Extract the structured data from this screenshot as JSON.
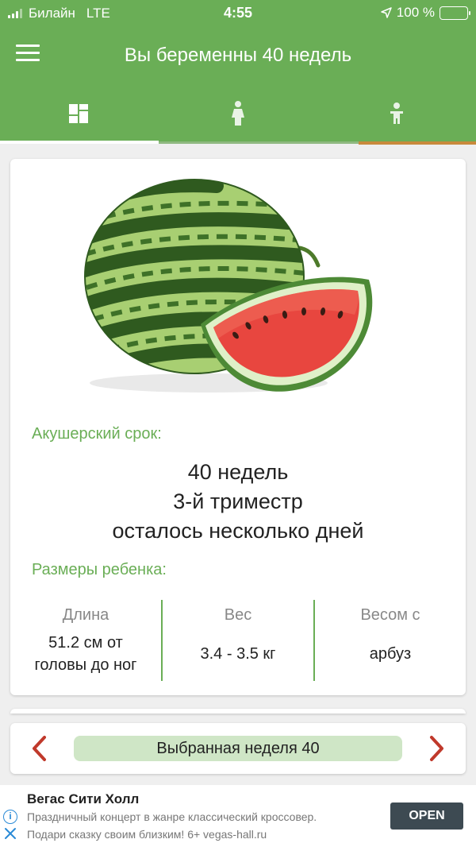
{
  "status_bar": {
    "carrier": "Билайн",
    "network": "LTE",
    "time": "4:55",
    "battery": "100 %",
    "battery_level": 1.0
  },
  "header": {
    "title": "Вы беременны 40 недель",
    "menu_icon": "hamburger-menu-icon",
    "tabs": [
      {
        "icon": "dashboard-grid-icon",
        "active": true
      },
      {
        "icon": "pregnant-woman-icon",
        "active": false
      },
      {
        "icon": "baby-child-icon",
        "active": false
      }
    ]
  },
  "main_card": {
    "image": "watermelon",
    "term_label": "Акушерский срок:",
    "term_lines": [
      "40 недель",
      "3-й триместр",
      "осталось несколько дней"
    ],
    "sizes_label": "Размеры ребенка:",
    "sizes": [
      {
        "head": "Длина",
        "value": "51.2 см от головы до ног"
      },
      {
        "head": "Вес",
        "value": "3.4 - 3.5 кг"
      },
      {
        "head": "Весом с",
        "value": "арбуз"
      }
    ]
  },
  "week_selector": {
    "label": "Выбранная неделя 40",
    "prev_icon": "chevron-left-icon",
    "next_icon": "chevron-right-icon"
  },
  "ad": {
    "title": "Вегас Сити Холл",
    "line1": "Праздничный концерт в жанре классический кроссовер.",
    "line2": "Подари сказку своим близким! 6+ vegas-hall.ru",
    "cta": "OPEN",
    "info_icon": "info-icon",
    "close_icon": "close-icon"
  },
  "colors": {
    "brand_green": "#6aae56",
    "tab_indicator": "#ffffff",
    "accent_orange": "#c88a3c",
    "arrow_red": "#c0392b",
    "week_pill": "#cfe6c6",
    "ad_button": "#3d4a52"
  }
}
